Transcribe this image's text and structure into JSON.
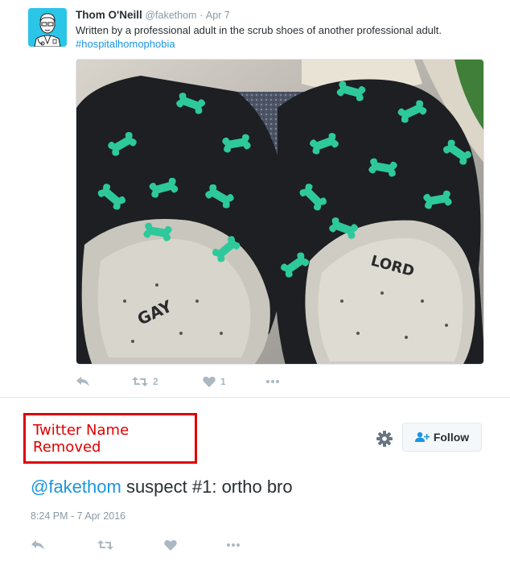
{
  "tweet": {
    "author_name": "Thom O'Neill",
    "author_handle": "@fakethom",
    "separator": "·",
    "date": "Apr 7",
    "text": "Written by a professional adult in the scrub shoes of another professional adult.",
    "hashtag": "#hospitalhomophobia",
    "photo_labels": {
      "left_shoe": "GAY",
      "right_shoe": "LORD"
    },
    "actions": {
      "reply_icon": "reply-icon",
      "retweet_icon": "retweet-icon",
      "retweet_count": "2",
      "like_icon": "heart-icon",
      "like_count": "1",
      "more_icon": "more-icon"
    }
  },
  "reply": {
    "redacted_label": "Twitter Name Removed",
    "follow_label": "Follow",
    "settings_icon": "gear-icon",
    "follow_icon": "add-user-icon",
    "mention": "@fakethom",
    "text": " suspect #1: ortho bro",
    "timestamp": "8:24 PM - 7 Apr 2016"
  },
  "colors": {
    "link": "#1b95e0",
    "text": "#292f33",
    "muted": "#8899a6",
    "icon": "#aab8c2",
    "redaction": "#e00000",
    "avatar_bg": "#2bc5e8",
    "shoe_print": "#2ec99a"
  }
}
